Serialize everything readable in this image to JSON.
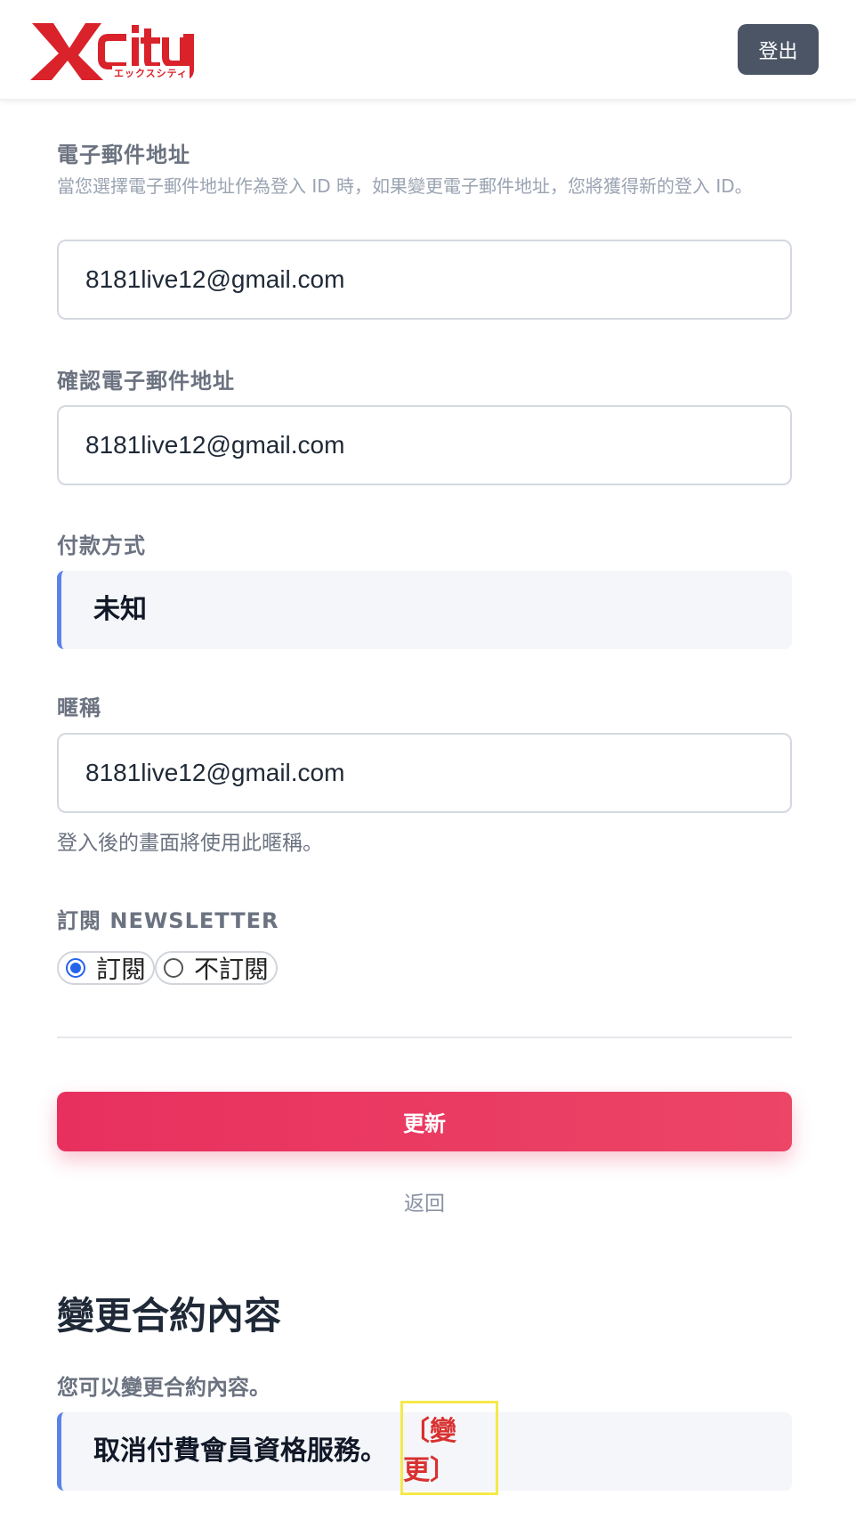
{
  "header": {
    "logo_text": "XCITY",
    "logo_subtext": "エックスシティ",
    "logout_label": "登出"
  },
  "email": {
    "label": "電子郵件地址",
    "help": "當您選擇電子郵件地址作為登入 ID 時，如果變更電子郵件地址，您將獲得新的登入 ID。",
    "value": "8181live12@gmail.com"
  },
  "confirm_email": {
    "label": "確認電子郵件地址",
    "value": "8181live12@gmail.com"
  },
  "payment": {
    "label": "付款方式",
    "value": "未知"
  },
  "nickname": {
    "label": "暱稱",
    "value": "8181live12@gmail.com",
    "help": "登入後的畫面將使用此暱稱。"
  },
  "newsletter": {
    "label": "訂閱 NEWSLETTER",
    "options": [
      {
        "label": "訂閱",
        "checked": true
      },
      {
        "label": "不訂閱",
        "checked": false
      }
    ]
  },
  "actions": {
    "update_label": "更新",
    "back_label": "返回"
  },
  "contract": {
    "title": "變更合約內容",
    "description": "您可以變更合約內容。",
    "item_text": "取消付費會員資格服務。",
    "change_link": "〔變更〕"
  },
  "colors": {
    "accent_pink": "#e8305f",
    "info_border_blue": "#5b82e8",
    "link_red": "#d93030",
    "highlight_yellow": "#f5e94a",
    "logo_red": "#d9222a"
  }
}
